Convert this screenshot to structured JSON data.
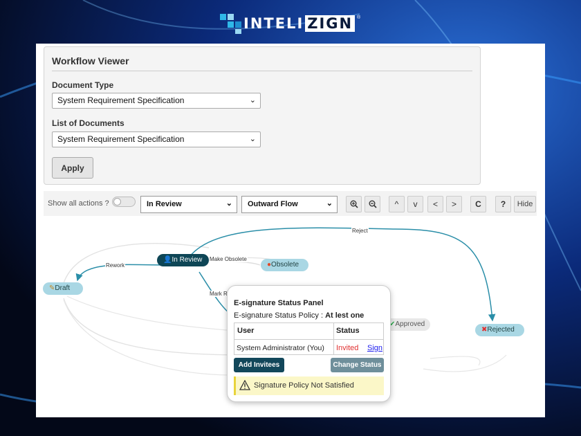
{
  "brand": {
    "logo_text_a": "INTELI",
    "logo_text_b": "ZIGN",
    "reg": "®"
  },
  "workflow_viewer": {
    "title": "Workflow Viewer",
    "document_type_label": "Document Type",
    "document_type_value": "System Requirement Specification",
    "list_label": "List of Documents",
    "list_value": "System Requirement Specification",
    "apply_label": "Apply"
  },
  "toolbar": {
    "show_all_actions": "Show all actions ?",
    "state_select": "In Review",
    "flow_select": "Outward Flow",
    "zoom_in": "⊕",
    "zoom_out": "⊖",
    "up": "^",
    "down": "v",
    "left": "<",
    "right": ">",
    "refresh": "C",
    "help": "?",
    "hide": "Hide"
  },
  "graph": {
    "nodes": {
      "draft": "Draft",
      "in_review": "In Review",
      "obsolete": "Obsolete",
      "approved": "Approved",
      "rejected": "Rejected"
    },
    "edges": {
      "reject": "Reject",
      "rework": "Rework",
      "make_obsolete": "Make Obsolete",
      "mark_review": "Mark Re"
    }
  },
  "esig_panel": {
    "title": "E-signature Status Panel",
    "policy_label": "E-signature Status Policy : ",
    "policy_value": "At lest one",
    "col_user": "User",
    "col_status": "Status",
    "row_user": "System Administrator (You)",
    "row_status": "Invited",
    "row_action": "Sign",
    "add_invitees": "Add Invitees",
    "change_status": "Change Status",
    "warning": "Signature Policy Not Satisfied"
  },
  "colors": {
    "accent_dark": "#0e4656",
    "node_light": "#a9d7e4",
    "edge": "#2a8ea8",
    "invited": "#e03030",
    "link": "#1a1aee"
  }
}
